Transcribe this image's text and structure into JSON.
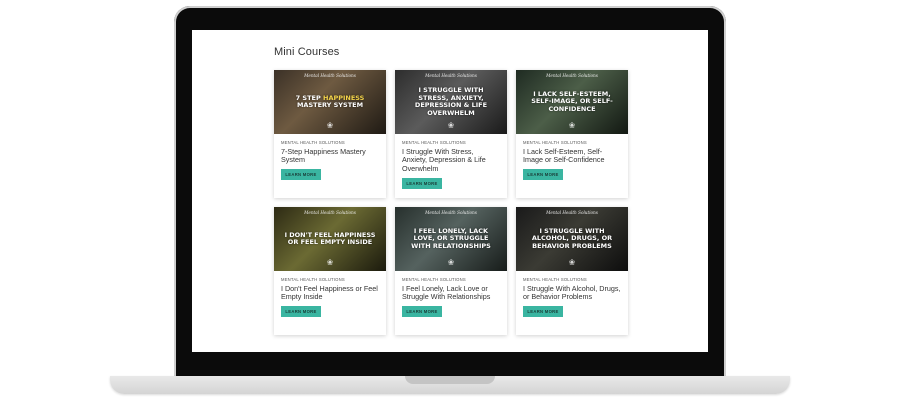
{
  "page": {
    "section_title": "Mini Courses"
  },
  "courses": [
    {
      "brand": "Mental Health Solutions",
      "thumb_lines": [
        "7 Step ",
        "Happiness",
        " Mastery System"
      ],
      "category": "Mental Health Solutions",
      "title": "7-Step Happiness Mastery System",
      "button": "Learn More"
    },
    {
      "brand": "Mental Health Solutions",
      "thumb_text": "I Struggle With Stress, Anxiety, Depression & Life Overwhelm",
      "category": "Mental Health Solutions",
      "title": "I Struggle With Stress, Anxiety, Depression & Life Overwhelm",
      "button": "Learn More"
    },
    {
      "brand": "Mental Health Solutions",
      "thumb_text": "I Lack Self-Esteem, Self-Image, or Self-Confidence",
      "category": "Mental Health Solutions",
      "title": "I Lack Self-Esteem, Self-Image or Self-Confidence",
      "button": "Learn More"
    },
    {
      "brand": "Mental Health Solutions",
      "thumb_text": "I Don't Feel Happiness or Feel Empty Inside",
      "category": "Mental Health Solutions",
      "title": "I Don't Feel Happiness or Feel Empty Inside",
      "button": "Learn More"
    },
    {
      "brand": "Mental Health Solutions",
      "thumb_text": "I Feel Lonely, Lack Love, or Struggle With Relationships",
      "category": "Mental Health Solutions",
      "title": "I Feel Lonely, Lack Love or Struggle With Relationships",
      "button": "Learn More"
    },
    {
      "brand": "Mental Health Solutions",
      "thumb_text": "I Struggle With Alcohol, Drugs, or Behavior Problems",
      "category": "Mental Health Solutions",
      "title": "I Struggle With Alcohol, Drugs, or Behavior Problems",
      "button": "Learn More"
    }
  ],
  "colors": {
    "accent": "#3ab5a1",
    "highlight": "#f2d24a",
    "frame": "#0b0b0b"
  },
  "icons": {
    "card_logo": "lotus-icon"
  }
}
